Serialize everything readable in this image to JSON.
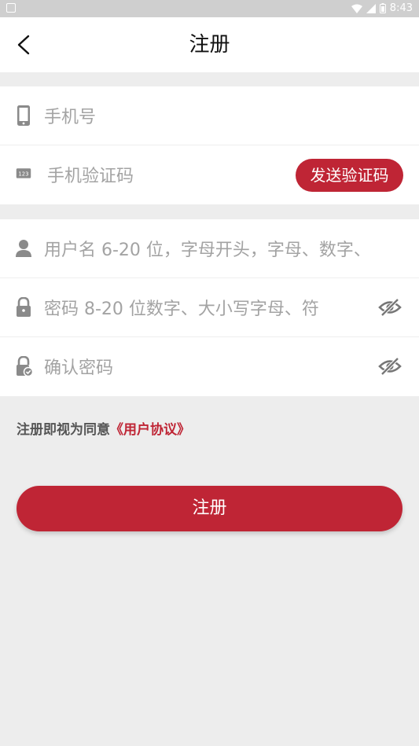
{
  "status_bar": {
    "time": "8:43"
  },
  "header": {
    "title": "注册"
  },
  "phone_group": {
    "phone_placeholder": "手机号",
    "code_placeholder": "手机验证码",
    "send_code_label": "发送验证码"
  },
  "account_group": {
    "username_placeholder": "用户名 6-20 位，字母开头，字母、数字、",
    "password_placeholder": "密码 8-20 位数字、大小写字母、符",
    "confirm_placeholder": "确认密码"
  },
  "agreement": {
    "prefix": "注册即视为同意",
    "link": "《用户协议》"
  },
  "submit_label": "注册",
  "colors": {
    "accent": "#bf2535",
    "background": "#ededed",
    "placeholder": "#a3a3a3"
  },
  "icons": [
    "back-arrow-icon",
    "phone-icon",
    "keypad-123-icon",
    "user-icon",
    "lock-icon",
    "lock-check-icon",
    "eye-off-icon"
  ]
}
